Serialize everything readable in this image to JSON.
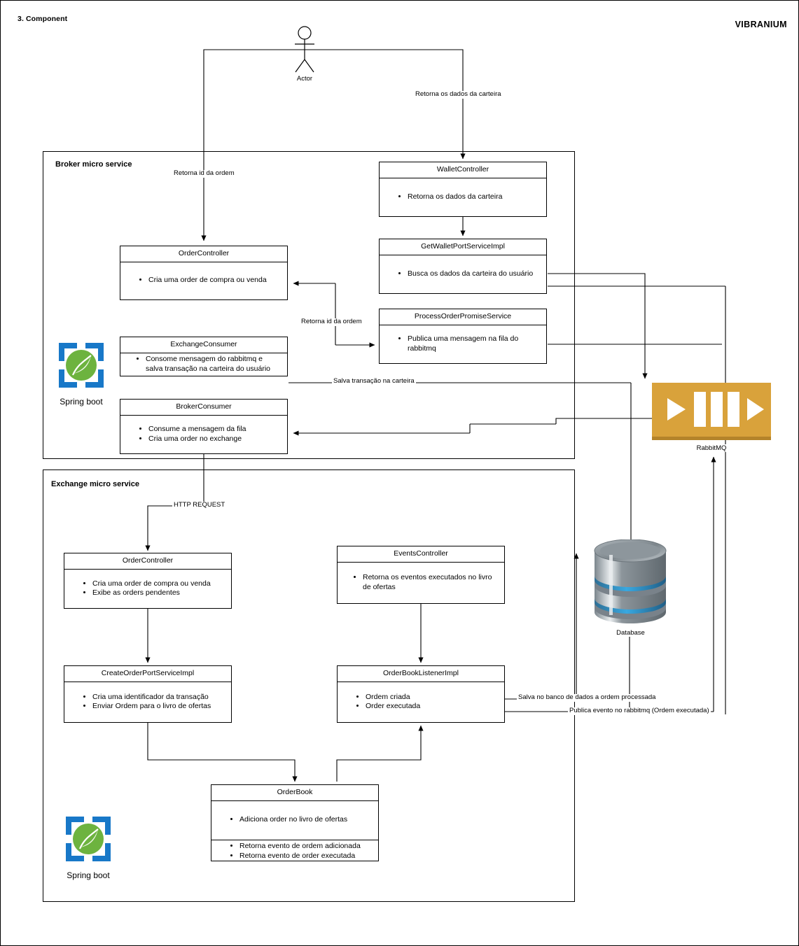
{
  "page": {
    "section_label": "3. Component",
    "brand": "VIBRANIUM"
  },
  "actor": {
    "name": "Actor",
    "icon": "actor-stick-figure-icon"
  },
  "groups": [
    {
      "id": "broker",
      "title": "Broker micro service"
    },
    {
      "id": "exchange",
      "title": "Exchange micro service"
    }
  ],
  "platform_badges": [
    {
      "id": "spring-broker",
      "label": "Spring boot",
      "icon": "spring-boot-leaf-icon"
    },
    {
      "id": "spring-exchange",
      "label": "Spring boot",
      "icon": "spring-boot-leaf-icon"
    }
  ],
  "infrastructure": [
    {
      "id": "rabbitmq",
      "label": "RabbitMQ",
      "icon": "rabbitmq-icon",
      "color": "#d9a23b"
    },
    {
      "id": "database",
      "label": "Database",
      "icon": "database-cylinder-icon",
      "color": "#7d868c"
    }
  ],
  "components": {
    "broker": [
      {
        "id": "broker-wallet-controller",
        "title": "WalletController",
        "sections": [
          {
            "items": [
              "Retorna os dados da carteira"
            ]
          }
        ]
      },
      {
        "id": "broker-order-controller",
        "title": "OrderController",
        "sections": [
          {
            "items": [
              "Cria uma order de compra ou venda"
            ]
          }
        ]
      },
      {
        "id": "broker-get-wallet-port-service-impl",
        "title": "GetWalletPortServiceImpl",
        "sections": [
          {
            "items": [
              "Busca os dados da carteira do usuário"
            ]
          }
        ]
      },
      {
        "id": "broker-process-order-promise-service",
        "title": "ProcessOrderPromiseService",
        "sections": [
          {
            "items": [
              "Publica uma mensagem na fila do rabbitmq"
            ]
          }
        ]
      },
      {
        "id": "broker-exchange-consumer",
        "title": "ExchangeConsumer",
        "sections": [
          {
            "items": [
              "Consome mensagem do rabbitmq e salva transação na carteira do usuário"
            ]
          }
        ]
      },
      {
        "id": "broker-consumer",
        "title": "BrokerConsumer",
        "sections": [
          {
            "items": [
              "Consume a mensagem da fila",
              "Cria uma order no exchange"
            ]
          }
        ]
      }
    ],
    "exchange": [
      {
        "id": "exchange-order-controller",
        "title": "OrderController",
        "sections": [
          {
            "items": [
              "Cria uma order de compra ou venda",
              "Exibe as orders pendentes"
            ]
          }
        ]
      },
      {
        "id": "exchange-events-controller",
        "title": "EventsController",
        "sections": [
          {
            "items": [
              "Retorna os eventos executados no livro de ofertas"
            ]
          }
        ]
      },
      {
        "id": "exchange-create-order-port-service-impl",
        "title": "CreateOrderPortServiceImpl",
        "sections": [
          {
            "items": [
              "Cria uma identificador da transação",
              "Enviar Ordem para o livro de ofertas"
            ]
          }
        ]
      },
      {
        "id": "exchange-order-book-listener-impl",
        "title": "OrderBookListenerImpl",
        "sections": [
          {
            "items": [
              "Ordem criada",
              "Order executada"
            ]
          }
        ]
      },
      {
        "id": "exchange-order-book",
        "title": "OrderBook",
        "sections": [
          {
            "items": [
              "Adiciona order no livro de ofertas"
            ]
          },
          {
            "items": [
              "Retorna evento de ordem adicionada",
              "Retorna evento de order executada"
            ]
          }
        ]
      }
    ]
  },
  "edge_labels": [
    {
      "id": "edge-retorna-dados-carteira",
      "text": "Retorna os dados da carteira"
    },
    {
      "id": "edge-retorna-id-ordem-top",
      "text": "Retorna id da ordem"
    },
    {
      "id": "edge-retorna-id-ordem-mid",
      "text": "Retorna id da ordem"
    },
    {
      "id": "edge-salva-transacao-carteira",
      "text": "Salva transação na carteira"
    },
    {
      "id": "edge-http-request",
      "text": "HTTP REQUEST"
    },
    {
      "id": "edge-salva-banco-dados",
      "text": "Salva no banco de dados a ordem processada"
    },
    {
      "id": "edge-publica-evento-rabbitmq",
      "text": "Publica evento no rabbitmq (Ordem executada)"
    }
  ]
}
